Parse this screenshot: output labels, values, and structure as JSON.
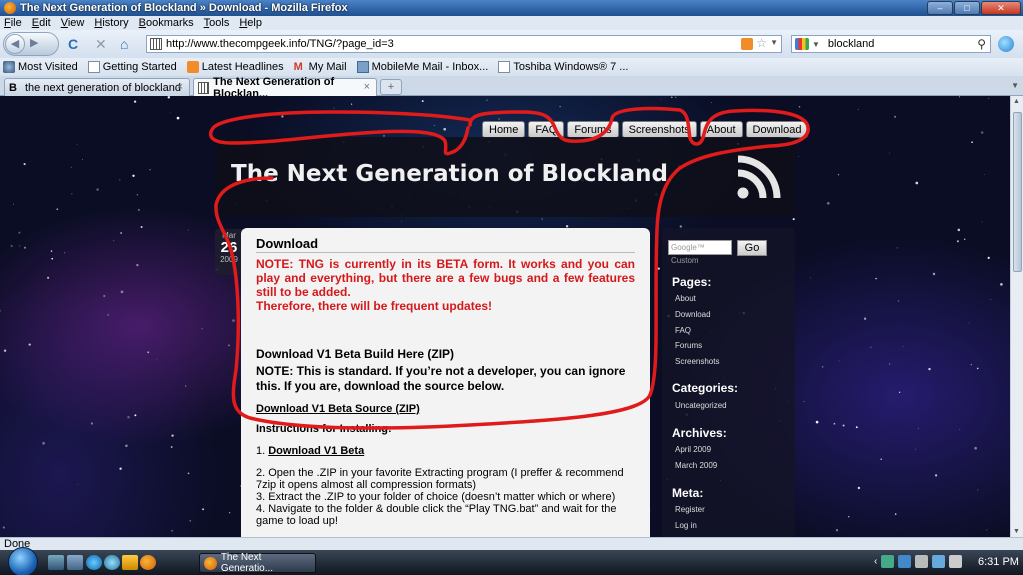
{
  "window": {
    "title": "The Next Generation of Blockland » Download - Mozilla Firefox",
    "controls": {
      "minimize": "–",
      "maximize": "□",
      "close": "✕"
    }
  },
  "menu": [
    "File",
    "Edit",
    "View",
    "History",
    "Bookmarks",
    "Tools",
    "Help"
  ],
  "navigation": {
    "back": "◀",
    "forward": "▶",
    "reload": "C",
    "stop": "✕",
    "home": "⌂",
    "url": "http://www.thecompgeek.info/TNG/?page_id=3",
    "search_value": "blockland",
    "search_icon": "⚲"
  },
  "bookmarks": [
    {
      "label": "Most Visited",
      "icon": "most-visited-icon"
    },
    {
      "label": "Getting Started",
      "icon": "page-icon"
    },
    {
      "label": "Latest Headlines",
      "icon": "rss-icon"
    },
    {
      "label": "My Mail",
      "icon": "gmail-icon"
    },
    {
      "label": "MobileMe Mail - Inbox...",
      "icon": "mobileme-icon"
    },
    {
      "label": "Toshiba Windows® 7 ...",
      "icon": "page-icon"
    }
  ],
  "tabs": [
    {
      "label": "the next generation of blockland",
      "active": false,
      "favicon": "B"
    },
    {
      "label": "The Next Generation of Blocklan...",
      "active": true
    }
  ],
  "tab_close": "×",
  "new_tab": "+",
  "site": {
    "nav": [
      "Home",
      "FAQ",
      "Forums",
      "Screenshots",
      "About",
      "Download"
    ],
    "title": "The Next Generation of Blockland",
    "date": {
      "month": "Mar",
      "day": "26",
      "year": "2009"
    },
    "post": {
      "heading": "Download",
      "beta_note": "NOTE: TNG is currently in its BETA form. It works and you can play and everything, but there are a few bugs and a few features still to be added.",
      "updates_note": "Therefore, there will be frequent updates!",
      "download_heading": "Download V1 Beta Build Here (ZIP)",
      "standard_note": "NOTE: This is standard. If you’re not a developer, you can ignore this. If you are, download the source below.",
      "source_link": "Download V1 Beta Source (ZIP)",
      "instructions_heading": "Instructions for Installing:",
      "step1_prefix": "1. ",
      "step1_link": "Download V1 Beta",
      "step2": "2. Open the .ZIP in your favorite Extracting program (I preffer & recommend 7zip it opens almost all compression formats)",
      "step3": "3. Extract the .ZIP to your folder of choice (doesn’t matter which or where)",
      "step4": "4. Navigate to the folder & double click the “Play TNG.bat” and wait for the game to load up!"
    },
    "sidebar": {
      "search_placeholder": "Google™ Custom",
      "go_button": "Go",
      "pages_heading": "Pages:",
      "pages": [
        "About",
        "Download",
        "FAQ",
        "Forums",
        "Screenshots"
      ],
      "categories_heading": "Categories:",
      "categories": [
        "Uncategorized"
      ],
      "archives_heading": "Archives:",
      "archives": [
        "April 2009",
        "March 2009"
      ],
      "meta_heading": "Meta:",
      "meta": [
        "Register",
        "Log in"
      ]
    }
  },
  "status": "Done",
  "taskbar": {
    "task_label": "The Next Generatio...",
    "clock": "6:31 PM"
  },
  "colors": {
    "note_red": "#d6181b",
    "annotation_red": "#e01b1b",
    "rss_orange": "#f28c28"
  }
}
